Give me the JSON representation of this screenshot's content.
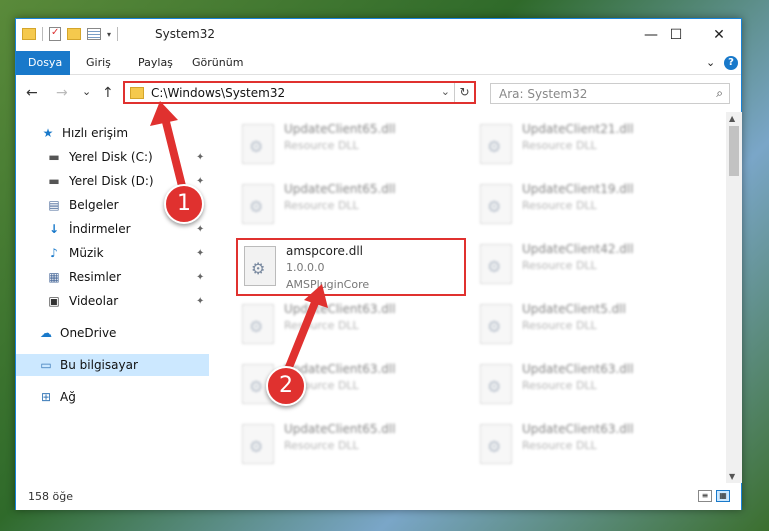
{
  "window": {
    "title": "System32",
    "minimize": "—",
    "maximize": "☐",
    "close": "✕"
  },
  "ribbon": {
    "tabs": [
      "Dosya",
      "Giriş",
      "Paylaş",
      "Görünüm"
    ],
    "expand": "⌄",
    "help": "?"
  },
  "nav": {
    "back": "←",
    "forward": "→",
    "recent": "⌄",
    "up": "↑",
    "address": "C:\\Windows\\System32",
    "address_dropdown": "⌄",
    "refresh": "↻",
    "search_placeholder": "Ara: System32",
    "search_icon": "🔍"
  },
  "sidebar": {
    "items": [
      {
        "label": "Hızlı erişim",
        "icon": "star-icon",
        "glyph": "★"
      },
      {
        "label": "Yerel Disk (C:)",
        "icon": "drive-icon",
        "glyph": "▬",
        "pinned": true
      },
      {
        "label": "Yerel Disk (D:)",
        "icon": "drive-icon",
        "glyph": "▬",
        "pinned": true
      },
      {
        "label": "Belgeler",
        "icon": "documents-icon",
        "glyph": "▤",
        "pinned": true
      },
      {
        "label": "İndirmeler",
        "icon": "download-icon",
        "glyph": "↓",
        "pinned": true
      },
      {
        "label": "Müzik",
        "icon": "music-icon",
        "glyph": "♪",
        "pinned": true
      },
      {
        "label": "Resimler",
        "icon": "pictures-icon",
        "glyph": "▦",
        "pinned": true
      },
      {
        "label": "Videolar",
        "icon": "videos-icon",
        "glyph": "▣",
        "pinned": true
      },
      {
        "label": "OneDrive",
        "icon": "cloud-icon",
        "glyph": "☁"
      },
      {
        "label": "Bu bilgisayar",
        "icon": "computer-icon",
        "glyph": "🖳"
      },
      {
        "label": "Ağ",
        "icon": "network-icon",
        "glyph": "⊞"
      }
    ],
    "pin_glyph": "📌"
  },
  "files": {
    "left": [
      {
        "name": "UpdateClient65.dll",
        "type": "Resource DLL"
      },
      {
        "name": "UpdateClient65.dll",
        "type": "Resource DLL"
      },
      {
        "name": "amspcore.dll",
        "version": "1.0.0.0",
        "type": "AMSPluginCore"
      },
      {
        "name": "UpdateClient63.dll",
        "type": "Resource DLL"
      },
      {
        "name": "UpdateClient63.dll",
        "type": "Resource DLL"
      },
      {
        "name": "UpdateClient65.dll",
        "type": "Resource DLL"
      }
    ],
    "right": [
      {
        "name": "UpdateClient21.dll",
        "type": "Resource DLL"
      },
      {
        "name": "UpdateClient19.dll",
        "type": "Resource DLL"
      },
      {
        "name": "UpdateClient42.dll",
        "type": "Resource DLL"
      },
      {
        "name": "UpdateClient5.dll",
        "type": "Resource DLL"
      },
      {
        "name": "UpdateClient63.dll",
        "type": "Resource DLL"
      },
      {
        "name": "UpdateClient63.dll",
        "type": "Resource DLL"
      }
    ]
  },
  "status": {
    "count": "158 öğe"
  },
  "annotations": {
    "step1": "1",
    "step2": "2"
  },
  "colors": {
    "accent": "#1979ca",
    "highlight": "#e0312f",
    "selected": "#cce8ff"
  }
}
